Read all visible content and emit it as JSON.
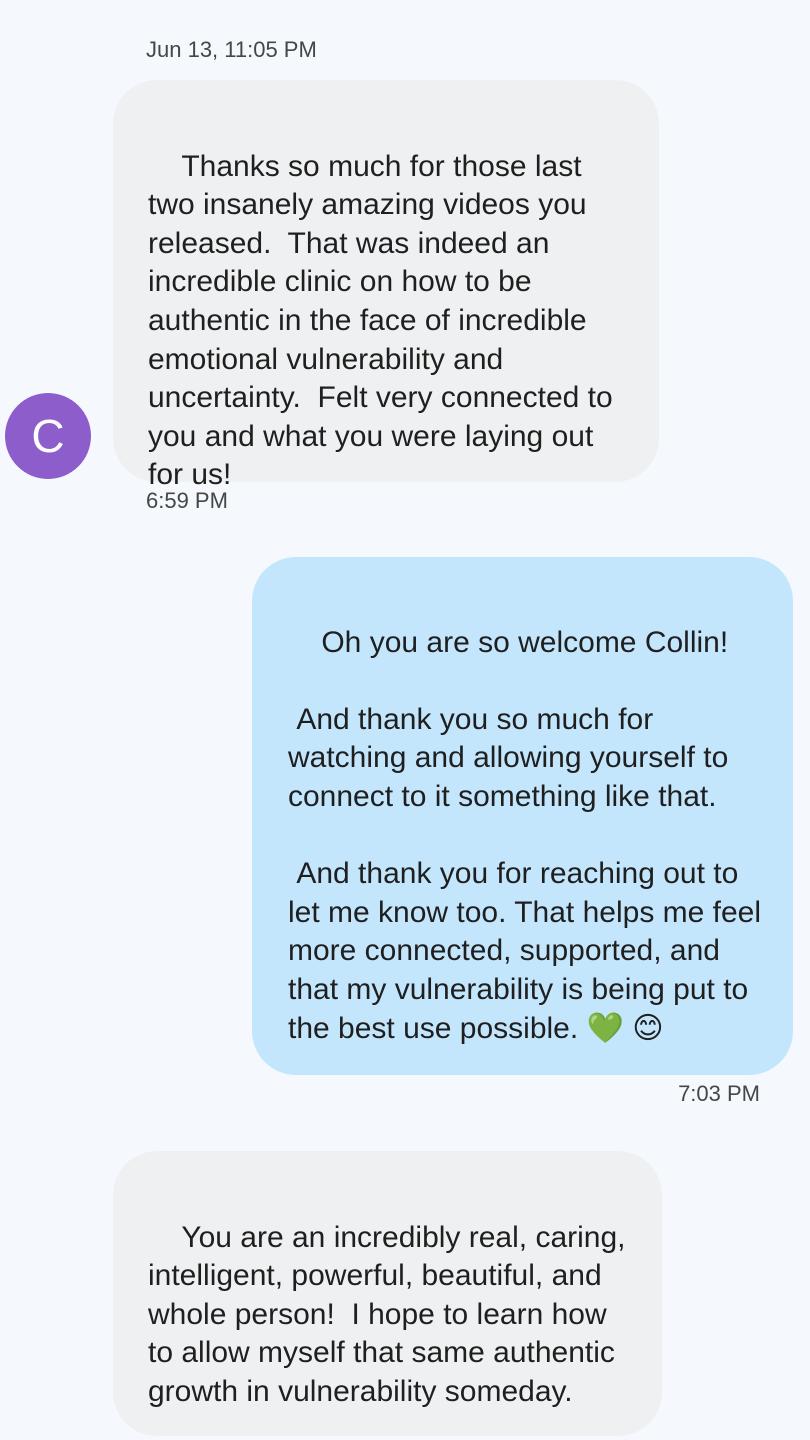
{
  "thread": {
    "date_separator": "Jun 13, 11:05 PM",
    "contact_avatar_letter": "C",
    "messages": [
      {
        "direction": "incoming",
        "text": "Thanks so much for those last two insanely amazing videos you released.  That was indeed an incredible clinic on how to be authentic in the face of incredible emotional vulnerability and uncertainty.  Felt very connected to you and what you were laying out for us!",
        "time": "6:59 PM"
      },
      {
        "direction": "outgoing",
        "text": "Oh you are so welcome Collin!\n\n And thank you so much for watching and allowing yourself to connect to it something like that.\n\n And thank you for reaching out to let me know too. That helps me feel more connected, supported, and that my vulnerability is being put to the best use possible. 💚 😊",
        "time": "7:03 PM"
      },
      {
        "direction": "incoming",
        "text": "You are an incredibly real, caring, intelligent, powerful, beautiful, and whole person!  I hope to learn how to allow myself that same authentic growth in vulnerability someday."
      }
    ]
  },
  "colors": {
    "background": "#f5f8fd",
    "incoming_bubble": "#eff0f1",
    "outgoing_bubble": "#c3e6fd",
    "avatar": "#8e5dcc"
  }
}
